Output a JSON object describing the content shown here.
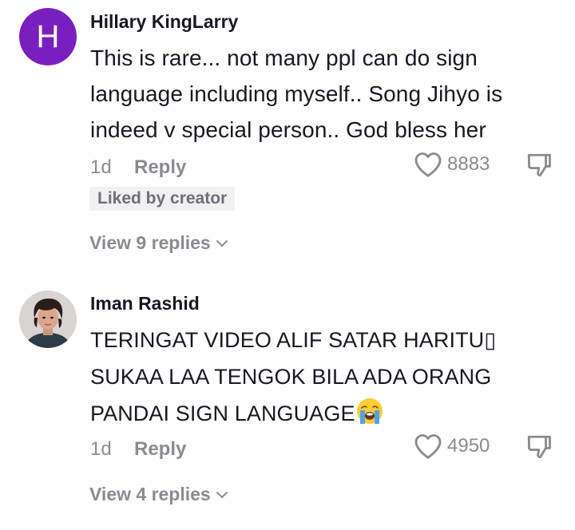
{
  "comments": [
    {
      "avatar_letter": "H",
      "avatar_color": "#7a1fbf",
      "username": "Hillary KingLarry",
      "text": "This is rare... not many ppl can do sign language including myself.. Song Jihyo is indeed v special person.. God bless her",
      "time": "1d",
      "reply_label": "Reply",
      "likes": "8883",
      "badge": "Liked by creator",
      "view_replies": "View 9 replies",
      "like_icon": "heart-outline-icon",
      "dislike_icon": "thumbs-down-icon"
    },
    {
      "avatar_type": "photo",
      "username": "Iman Rashid",
      "text_line1": "TERINGAT VIDEO ALIF SATAR HARITU▯",
      "text_line2": "SUKAA LAA TENGOK BILA ADA ORANG",
      "text_line3": "PANDAI SIGN LANGUAGE",
      "emoji": "loudly-crying-face-emoji",
      "time": "1d",
      "reply_label": "Reply",
      "likes": "4950",
      "view_replies": "View 4 replies",
      "like_icon": "heart-outline-icon",
      "dislike_icon": "thumbs-down-icon"
    }
  ],
  "colors": {
    "primary_text": "#161823",
    "secondary_text": "#8a8b91",
    "badge_bg": "#f1f1f2"
  }
}
